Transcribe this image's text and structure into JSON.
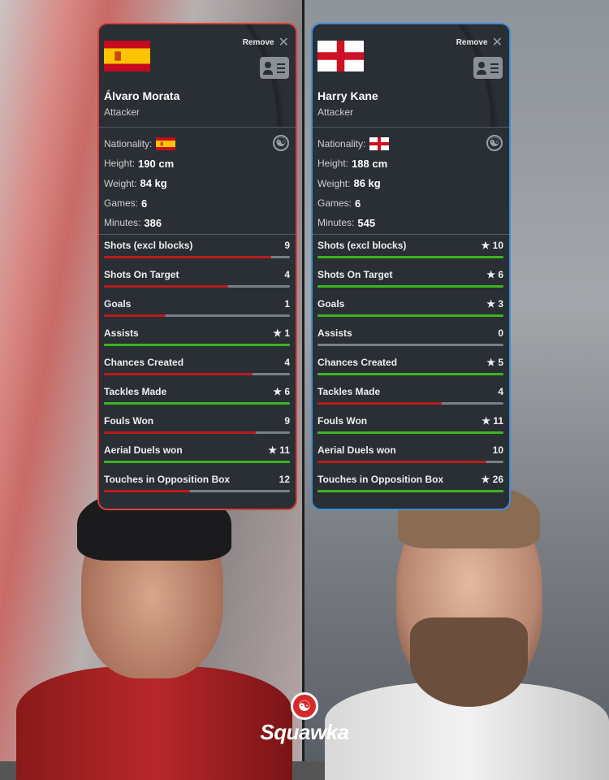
{
  "players": [
    {
      "name": "Álvaro Morata",
      "role": "Attacker",
      "flag": "spain",
      "nationality_label": "Nationality:",
      "height_label": "Height:",
      "height": "190 cm",
      "weight_label": "Weight:",
      "weight": "84 kg",
      "games_label": "Games:",
      "games": "6",
      "minutes_label": "Minutes:",
      "minutes": "386",
      "remove_label": "Remove",
      "border_color": "#d9403c"
    },
    {
      "name": "Harry Kane",
      "role": "Attacker",
      "flag": "england",
      "nationality_label": "Nationality:",
      "height_label": "Height:",
      "height": "188 cm",
      "weight_label": "Weight:",
      "weight": "86 kg",
      "games_label": "Games:",
      "games": "6",
      "minutes_label": "Minutes:",
      "minutes": "545",
      "remove_label": "Remove",
      "border_color": "#3d8fd9"
    }
  ],
  "stats": [
    {
      "label": "Shots (excl blocks)",
      "values": [
        9,
        10
      ],
      "display": [
        "9",
        "★ 10"
      ]
    },
    {
      "label": "Shots On Target",
      "values": [
        4,
        6
      ],
      "display": [
        "4",
        "★ 6"
      ]
    },
    {
      "label": "Goals",
      "values": [
        1,
        3
      ],
      "display": [
        "1",
        "★ 3"
      ]
    },
    {
      "label": "Assists",
      "values": [
        1,
        0
      ],
      "display": [
        "★ 1",
        "0"
      ]
    },
    {
      "label": "Chances Created",
      "values": [
        4,
        5
      ],
      "display": [
        "4",
        "★ 5"
      ]
    },
    {
      "label": "Tackles Made",
      "values": [
        6,
        4
      ],
      "display": [
        "★ 6",
        "4"
      ]
    },
    {
      "label": "Fouls Won",
      "values": [
        9,
        11
      ],
      "display": [
        "9",
        "★ 11"
      ]
    },
    {
      "label": "Aerial Duels won",
      "values": [
        11,
        10
      ],
      "display": [
        "★ 11",
        "10"
      ]
    },
    {
      "label": "Touches in Opposition Box",
      "values": [
        12,
        26
      ],
      "display": [
        "12",
        "★ 26"
      ]
    }
  ],
  "colors": {
    "winner": "#3cb520",
    "loser": "#b81c1c",
    "track": "#7a7e86"
  },
  "brand": {
    "name": "Squawka"
  }
}
